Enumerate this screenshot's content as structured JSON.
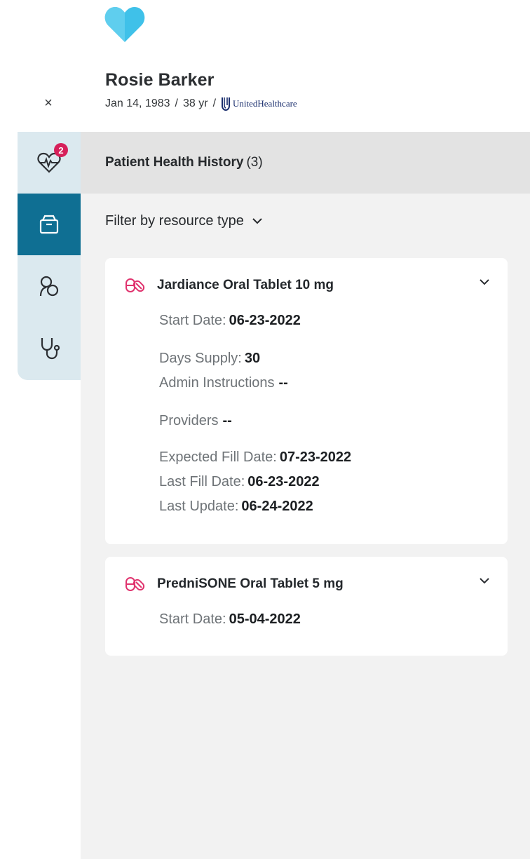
{
  "colors": {
    "accent": "#0f6f93",
    "rail_bg": "#dbe9ef",
    "badge": "#d6205a",
    "logo": "#3fc1e9",
    "pill": "#e0336e"
  },
  "window": {
    "close_label": "×"
  },
  "patient": {
    "name": "Rosie Barker",
    "dob": "Jan 14, 1983",
    "separator": "/",
    "age": "38 yr",
    "insurer": "UnitedHealthcare"
  },
  "rail": {
    "items": [
      {
        "icon": "heart-monitor-icon",
        "badge": "2",
        "active": false
      },
      {
        "icon": "medication-box-icon",
        "active": true
      },
      {
        "icon": "allergy-icon",
        "active": false
      },
      {
        "icon": "stethoscope-icon",
        "active": false
      }
    ]
  },
  "history": {
    "title": "Patient Health History",
    "count": "(3)"
  },
  "filter": {
    "label": "Filter by resource type"
  },
  "cards": [
    {
      "icon": "pill-icon",
      "title": "Jardiance Oral Tablet 10 mg",
      "start_label": "Start Date:",
      "start_value": "06-23-2022",
      "days_label": "Days Supply:",
      "days_value": "30",
      "admin_label": "Admin Instructions",
      "admin_value": "--",
      "providers_label": "Providers",
      "providers_value": "--",
      "expected_label": "Expected Fill Date:",
      "expected_value": "07-23-2022",
      "lastfill_label": "Last Fill Date:",
      "lastfill_value": "06-23-2022",
      "lastupdate_label": "Last Update:",
      "lastupdate_value": "06-24-2022"
    },
    {
      "icon": "pill-icon",
      "title": "PredniSONE Oral Tablet 5 mg",
      "start_label": "Start Date:",
      "start_value": "05-04-2022"
    }
  ]
}
